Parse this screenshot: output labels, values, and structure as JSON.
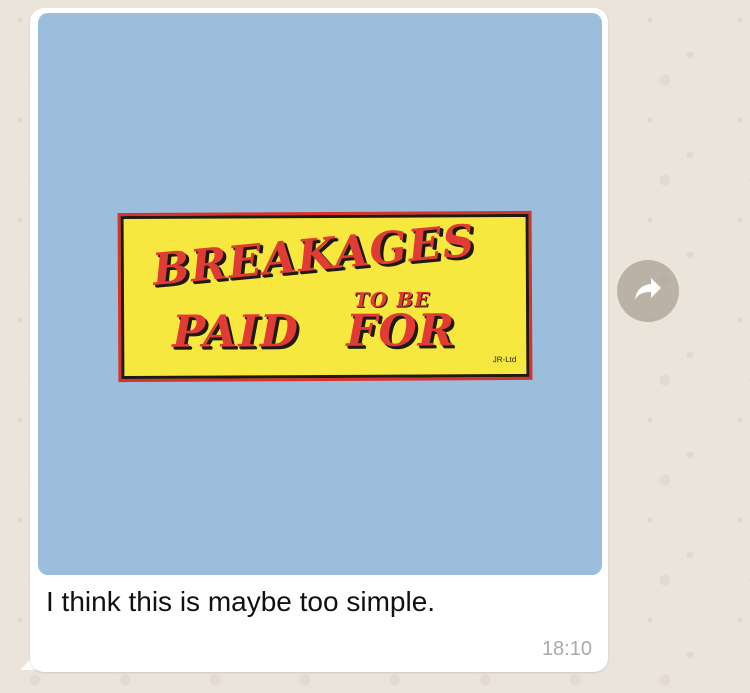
{
  "message": {
    "image": {
      "sign_lines": [
        "BREAKAGES",
        "TO BE",
        "PAID",
        "FOR"
      ],
      "sign_mark": "JR-Ltd",
      "background_color": "#9bbedc"
    },
    "caption": "I think this is maybe too simple.",
    "time": "18:10"
  },
  "forward": {
    "icon": "forward-arrow-icon",
    "color": "#aaa096"
  }
}
